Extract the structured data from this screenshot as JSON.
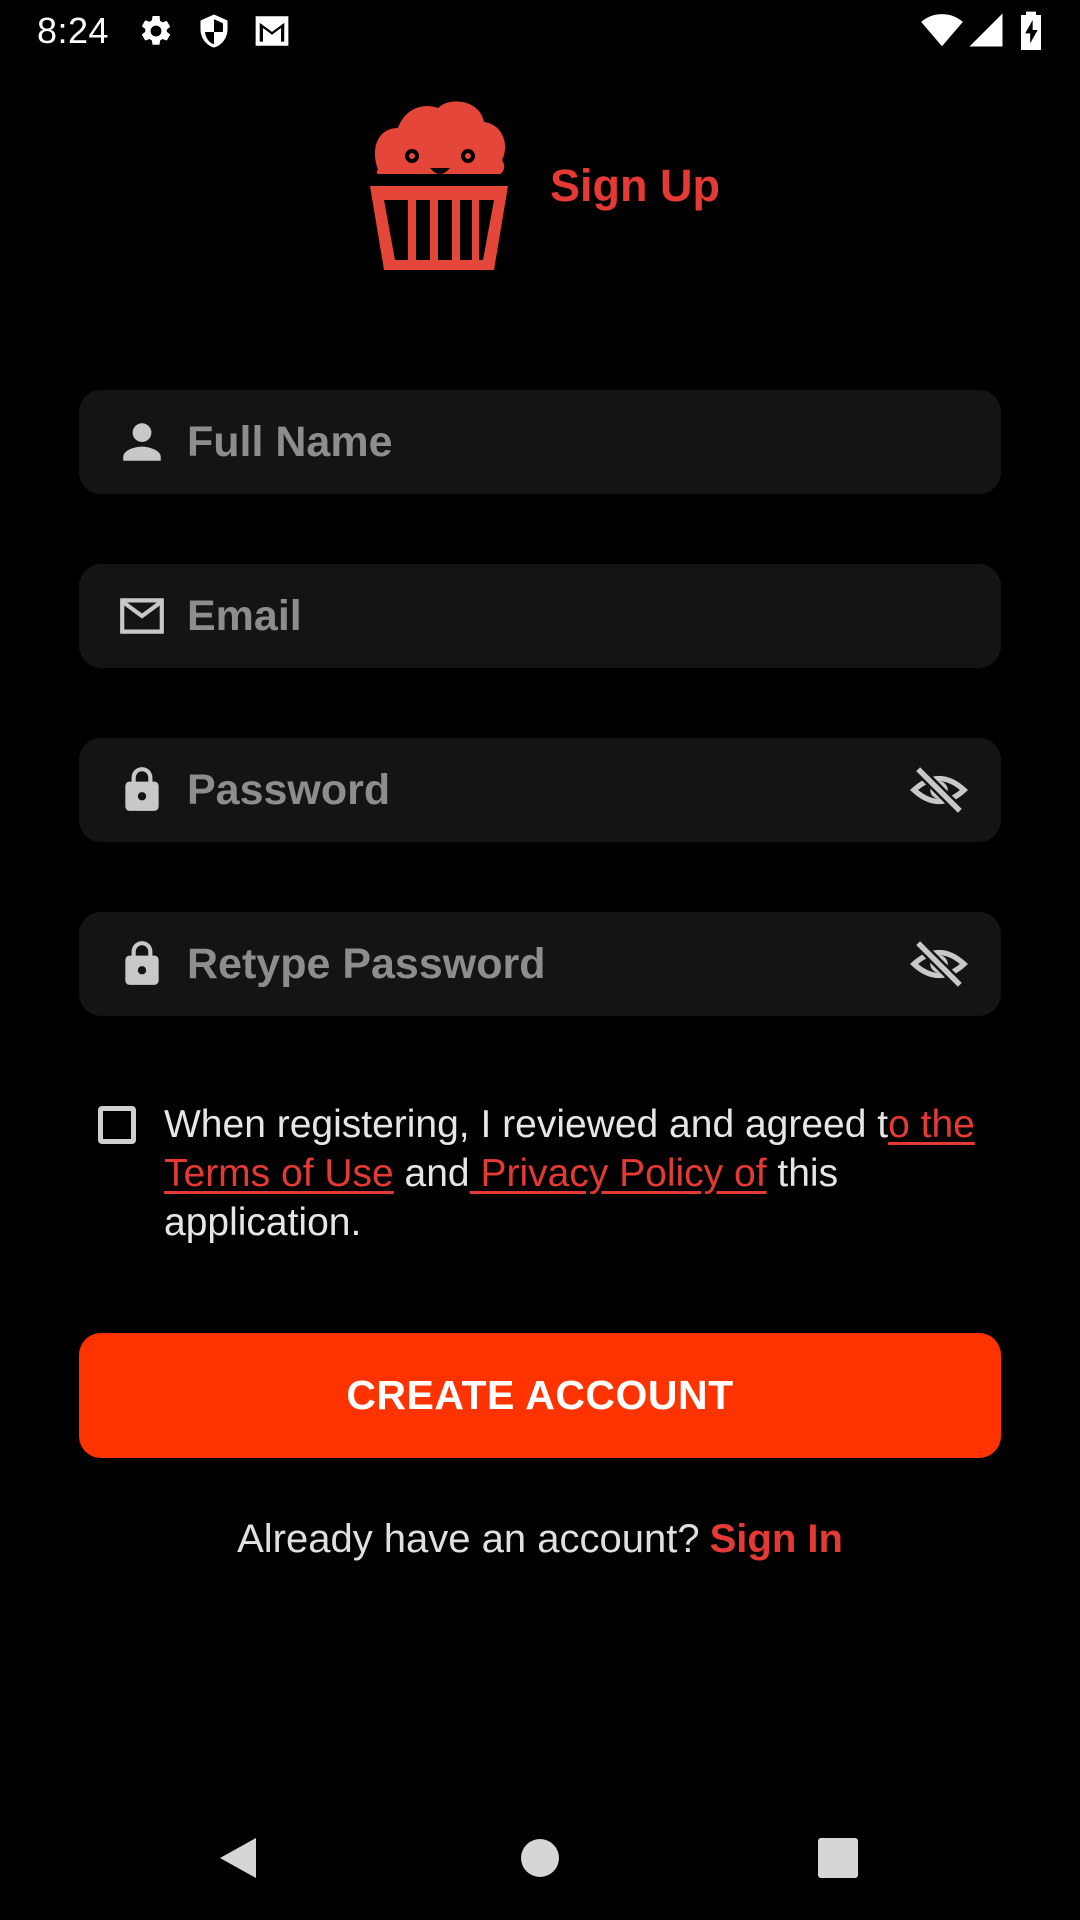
{
  "status_bar": {
    "time": "8:24",
    "icons_left": [
      "gear-icon",
      "shield-icon",
      "gmail-icon"
    ],
    "icons_right": [
      "wifi-icon",
      "signal-icon",
      "battery-charging-icon"
    ]
  },
  "header": {
    "logo_icon": "cupcake-logo-icon",
    "title": "Sign Up"
  },
  "form": {
    "full_name": {
      "placeholder": "Full Name",
      "icon": "person-icon"
    },
    "email": {
      "placeholder": "Email",
      "icon": "mail-icon"
    },
    "password": {
      "placeholder": "Password",
      "icon": "lock-icon",
      "toggle_icon": "eye-off-icon"
    },
    "retype_password": {
      "placeholder": "Retype Password",
      "icon": "lock-icon",
      "toggle_icon": "eye-off-icon"
    }
  },
  "terms": {
    "checked": false,
    "text_part1": "When registering, I reviewed and agreed t",
    "link1": "o the Terms of Use",
    "text_part2": " and",
    "link2": " Privacy Policy of",
    "text_part3": " this application."
  },
  "create_button": "CREATE ACCOUNT",
  "signin": {
    "prompt": "Already have an account?",
    "link": "Sign In"
  },
  "colors": {
    "accent": "#e53935",
    "button": "#ff3300",
    "field_bg": "#141414",
    "placeholder": "#8d8d8d",
    "background": "#000000"
  },
  "nav_bar": [
    "back-icon",
    "home-icon",
    "recents-icon"
  ]
}
